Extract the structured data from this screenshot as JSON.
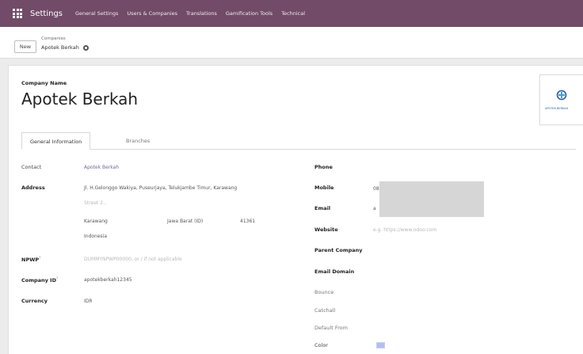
{
  "navbar": {
    "app_title": "Settings",
    "items": [
      "General Settings",
      "Users & Companies",
      "Translations",
      "Gamification Tools",
      "Technical"
    ]
  },
  "control": {
    "new_label": "New",
    "breadcrumb_parent": "Companies",
    "breadcrumb_current": "Apotek Berkah"
  },
  "form": {
    "company_name_label": "Company Name",
    "company_name": "Apotek Berkah",
    "logo_text": "APOTEK BERKAH",
    "tabs": [
      "General Information",
      "Branches"
    ],
    "left": {
      "contact_label": "Contact",
      "contact_value": "Apotek Berkah",
      "address_label": "Address",
      "street": "Jl. H.Gelonggo Wakiya, Puseurjaya, Telukjambe Timur, Karawang",
      "street2": "Street 2...",
      "city": "Karawang",
      "state": "Jawa Barat (ID)",
      "zip": "41361",
      "country": "Indonesia",
      "npwp_label": "NPWP",
      "npwp_value": "DUMMYNPWP00000, or / if not applicable",
      "company_id_label": "Company ID",
      "company_id_value": "apotekberkah12345",
      "currency_label": "Currency",
      "currency_value": "IDR"
    },
    "right": {
      "phone_label": "Phone",
      "mobile_label": "Mobile",
      "mobile_value": "08",
      "email_label": "Email",
      "email_value": "a",
      "website_label": "Website",
      "website_placeholder": "e.g. https://www.odoo.com",
      "parent_company_label": "Parent Company",
      "email_domain_label": "Email Domain",
      "bounce_label": "Bounce",
      "catchall_label": "Catchall",
      "default_from_label": "Default From",
      "color_label": "Color",
      "color_value": "#b3bff0"
    }
  }
}
